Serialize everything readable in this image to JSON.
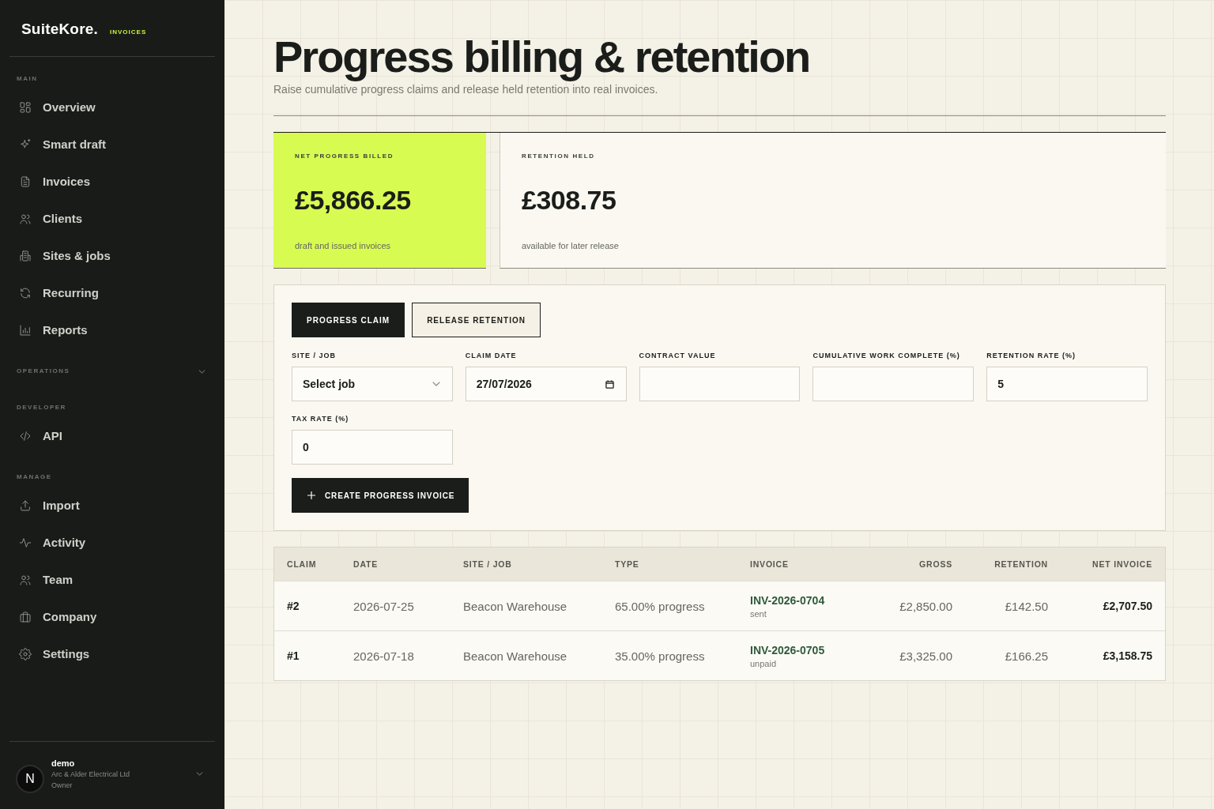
{
  "sidebar": {
    "brand": {
      "name": "SuiteKore.",
      "product": "INVOICES"
    },
    "sections": [
      {
        "label": "MAIN",
        "items": [
          {
            "label": "Overview",
            "selected": false
          },
          {
            "label": "Smart draft",
            "selected": false
          },
          {
            "label": "Invoices",
            "selected": false
          },
          {
            "label": "Clients",
            "selected": false
          },
          {
            "label": "Sites & jobs",
            "selected": false
          },
          {
            "label": "Recurring",
            "selected": false
          },
          {
            "label": "Reports",
            "selected": false
          }
        ]
      },
      {
        "label": "OPERATIONS",
        "expanded": false
      },
      {
        "label": "DEVELOPER",
        "items": [
          {
            "label": "API",
            "selected": false
          }
        ]
      },
      {
        "label": "MANAGE",
        "items": [
          {
            "label": "Import",
            "selected": false
          },
          {
            "label": "Activity",
            "selected": false
          },
          {
            "label": "Team",
            "selected": false
          },
          {
            "label": "Company",
            "selected": false
          },
          {
            "label": "Settings",
            "selected": false
          }
        ]
      }
    ],
    "user": {
      "initial": "N",
      "name": "demo",
      "company": "Arc & Alder Electrical Ltd",
      "role": "Owner"
    }
  },
  "header": {
    "title": "Progress billing & retention",
    "subtitle": "Raise cumulative progress claims and release held retention into real invoices."
  },
  "stats": [
    {
      "label": "NET PROGRESS BILLED",
      "value": "£5,866.25",
      "note": "draft and issued invoices",
      "highlighted": true
    },
    {
      "label": "RETENTION HELD",
      "value": "£308.75",
      "note": "available for later release",
      "highlighted": false
    }
  ],
  "form": {
    "tabs": [
      {
        "label": "PROGRESS CLAIM",
        "selected": true
      },
      {
        "label": "RELEASE RETENTION",
        "selected": false
      }
    ],
    "fields": [
      {
        "label": "SITE / JOB",
        "kind": "select",
        "value": "Select job"
      },
      {
        "label": "CLAIM DATE",
        "kind": "date",
        "value": "27/07/2026"
      },
      {
        "label": "CONTRACT VALUE",
        "kind": "text"
      },
      {
        "label": "CUMULATIVE WORK COMPLETE (%)",
        "kind": "text"
      },
      {
        "label": "RETENTION RATE (%)",
        "kind": "text",
        "value": "5"
      },
      {
        "label": "TAX RATE (%)",
        "kind": "text",
        "value": "0"
      }
    ],
    "submit": {
      "label": "CREATE PROGRESS INVOICE"
    }
  },
  "table": {
    "columns": [
      "CLAIM",
      "DATE",
      "SITE / JOB",
      "TYPE",
      "INVOICE",
      "GROSS",
      "RETENTION",
      "NET INVOICE"
    ],
    "rows": [
      {
        "claim": "#2",
        "date": "2026-07-25",
        "site": "Beacon Warehouse",
        "type": "65.00% progress",
        "invoice": "INV-2026-0704",
        "status": "sent",
        "gross": "£2,850.00",
        "retention": "£142.50",
        "net": "£2,707.50"
      },
      {
        "claim": "#1",
        "date": "2026-07-18",
        "site": "Beacon Warehouse",
        "type": "35.00% progress",
        "invoice": "INV-2026-0705",
        "status": "unpaid",
        "gross": "£3,325.00",
        "retention": "£166.25",
        "net": "£3,158.75"
      }
    ]
  }
}
